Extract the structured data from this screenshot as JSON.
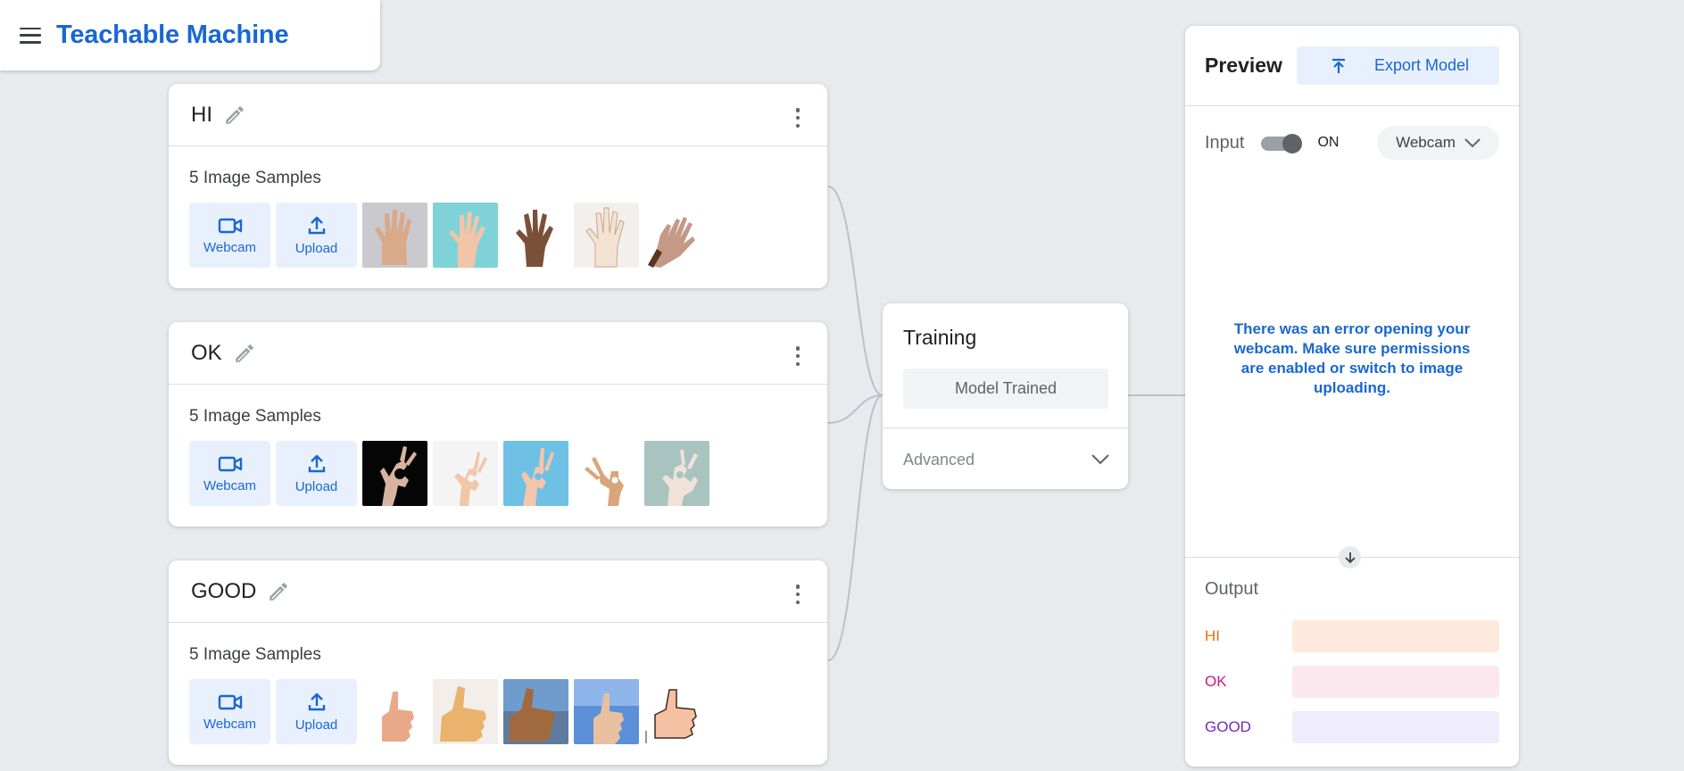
{
  "app": {
    "title": "Teachable Machine"
  },
  "classes": [
    {
      "name": "HI",
      "samples_label": "5 Image Samples",
      "webcam_label": "Webcam",
      "upload_label": "Upload"
    },
    {
      "name": "OK",
      "samples_label": "5 Image Samples",
      "webcam_label": "Webcam",
      "upload_label": "Upload"
    },
    {
      "name": "GOOD",
      "samples_label": "5 Image Samples",
      "webcam_label": "Webcam",
      "upload_label": "Upload"
    }
  ],
  "training": {
    "title": "Training",
    "button_label": "Model Trained",
    "advanced_label": "Advanced"
  },
  "preview": {
    "title": "Preview",
    "export_label": "Export Model",
    "input_label": "Input",
    "toggle_state": "ON",
    "source_label": "Webcam",
    "error_message": "There was an error opening your webcam. Make sure permissions are enabled or switch to image uploading.",
    "output_title": "Output",
    "outputs": [
      {
        "label": "HI",
        "color": "#e8710a",
        "bar_color": "#fdeadc",
        "confidence": 0
      },
      {
        "label": "OK",
        "color": "#d01884",
        "bar_color": "#fde7ee",
        "confidence": 0
      },
      {
        "label": "GOOD",
        "color": "#7627bb",
        "bar_color": "#efedfb",
        "confidence": 0
      }
    ]
  },
  "colors": {
    "accent": "#1967d2",
    "background": "#e8eaed"
  },
  "icons": [
    "menu-icon",
    "pencil-icon",
    "more-vert-icon",
    "videocam-icon",
    "upload-icon",
    "chevron-down-icon",
    "export-icon",
    "arrow-down-icon"
  ]
}
